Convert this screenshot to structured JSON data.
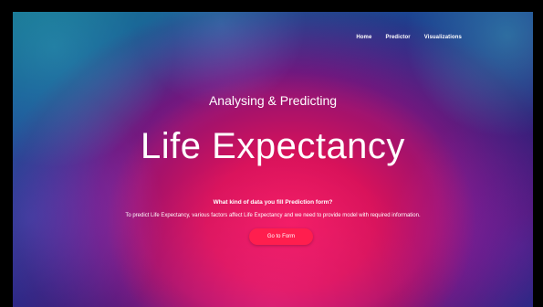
{
  "nav": {
    "items": [
      {
        "label": "Home"
      },
      {
        "label": "Predictor"
      },
      {
        "label": "Visualizations"
      }
    ]
  },
  "hero": {
    "subtitle": "Analysing & Predicting",
    "title": "Life Expectancy",
    "question": "What kind of data you fill Prediction form?",
    "description": "To predict Life Expectancy, various factors affect Life Expectancy and we need to provide model with required information.",
    "cta_label": "Go to Form"
  },
  "colors": {
    "accent": "#ff1e4e",
    "text": "#ffffff"
  }
}
